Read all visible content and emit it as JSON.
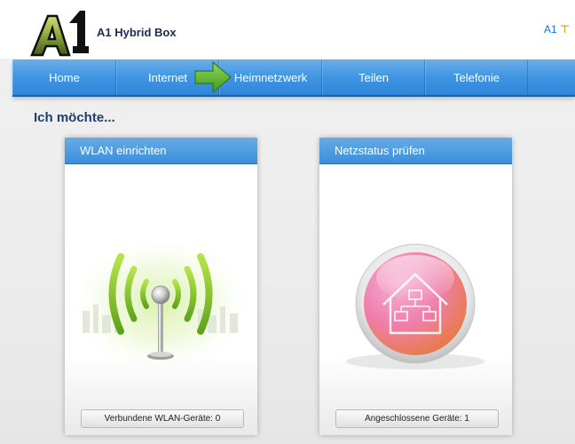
{
  "header": {
    "logo_icon": "a1-logo-icon",
    "app_title": "A1 Hybrid Box",
    "user_menu_label": "A1",
    "user_menu_icon": "flag-icon"
  },
  "nav": {
    "tabs": [
      {
        "label": "Home"
      },
      {
        "label": "Internet"
      },
      {
        "label": "Heimnetzwerk"
      },
      {
        "label": "Teilen"
      },
      {
        "label": "Telefonie"
      }
    ],
    "annotation_icon": "green-arrow-icon",
    "accent_color": "#4196e3"
  },
  "main": {
    "section_title": "Ich möchte...",
    "cards": [
      {
        "title": "WLAN einrichten",
        "icon": "wifi-antenna-icon",
        "status": "Verbundene WLAN-Geräte: 0"
      },
      {
        "title": "Netzstatus prüfen",
        "icon": "home-network-icon",
        "status": "Angeschlossene Geräte: 1"
      }
    ]
  }
}
